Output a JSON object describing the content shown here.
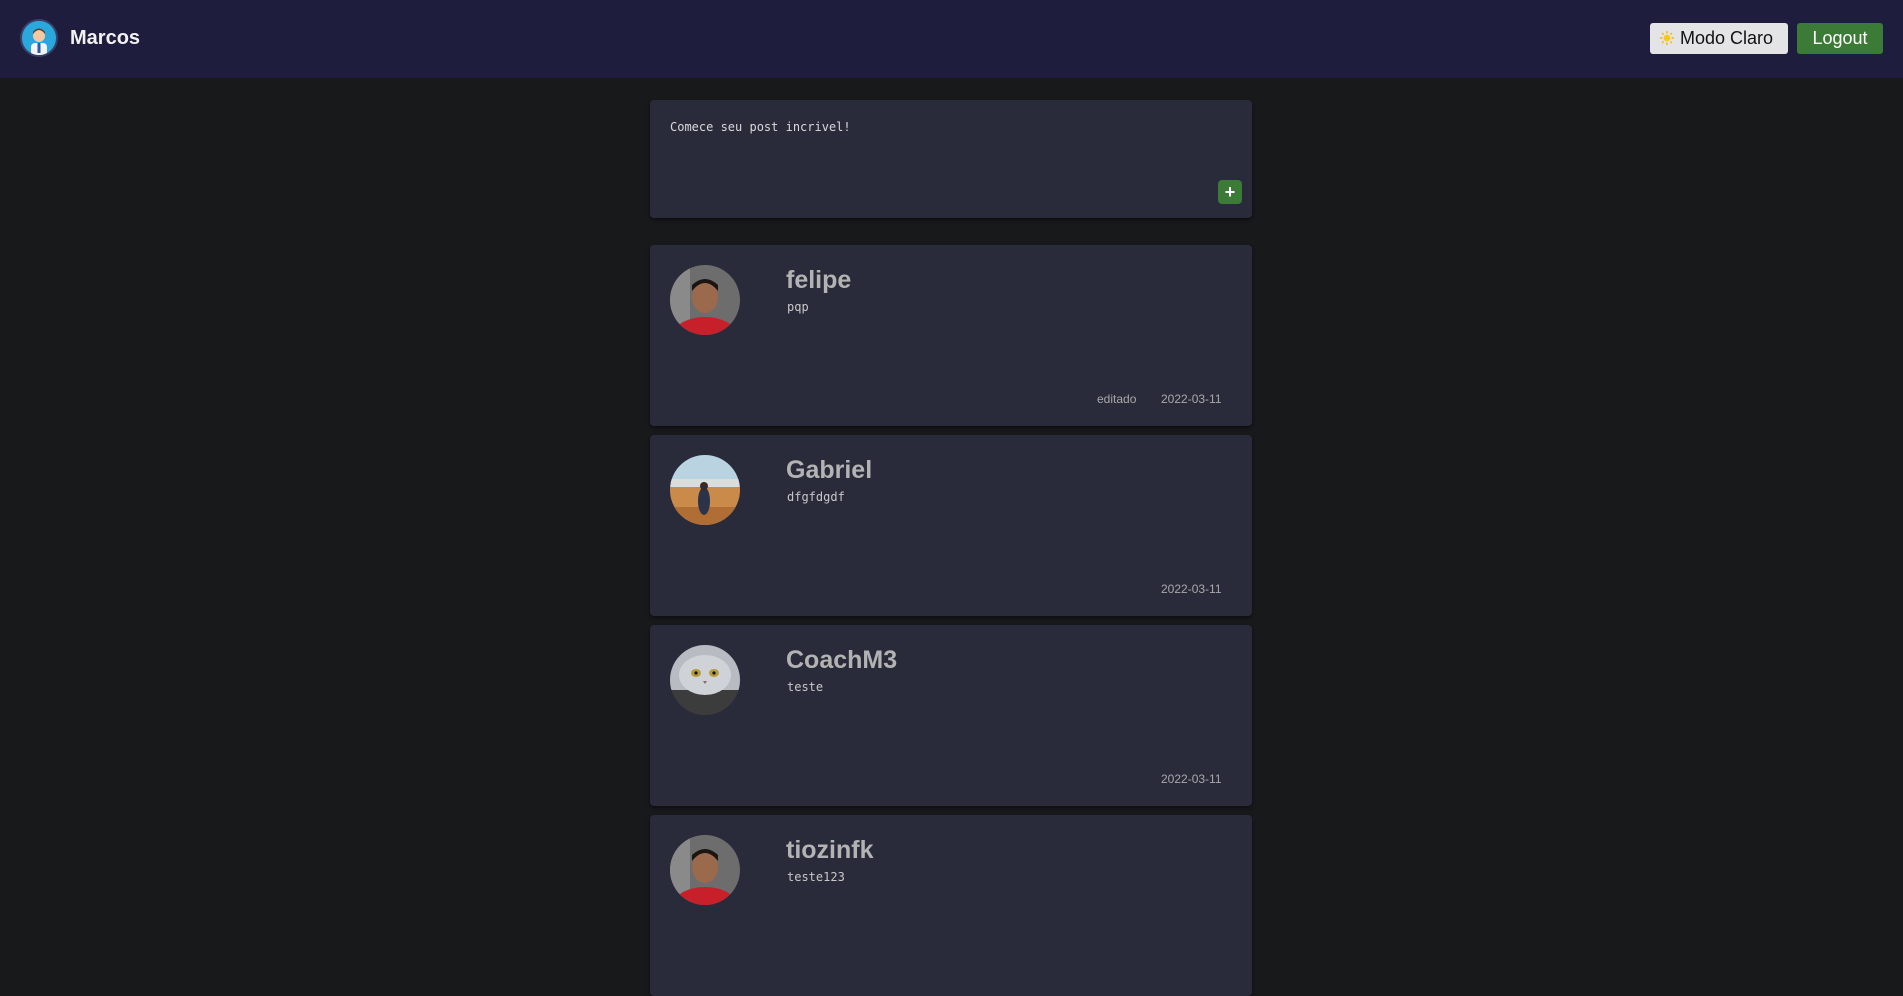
{
  "header": {
    "user_name": "Marcos",
    "theme_button_label": "Modo Claro",
    "theme_icon": "sun-icon",
    "logout_label": "Logout"
  },
  "composer": {
    "placeholder": "Comece seu post incrivel!",
    "add_label": "+"
  },
  "posts": [
    {
      "author": "felipe",
      "body": "pqp",
      "edited": "editado",
      "date": "2022-03-11",
      "avatar": "avatar-photo-man-red-shirt"
    },
    {
      "author": "Gabriel",
      "body": "dfgfdgdf",
      "edited": "",
      "date": "2022-03-11",
      "avatar": "avatar-photo-landscape"
    },
    {
      "author": "CoachM3",
      "body": "teste",
      "edited": "",
      "date": "2022-03-11",
      "avatar": "avatar-photo-cat"
    },
    {
      "author": "tiozinfk",
      "body": "teste123",
      "edited": "",
      "date": "",
      "avatar": "avatar-photo-man-red-shirt"
    }
  ],
  "colors": {
    "header_bg": "#1e1d3d",
    "page_bg": "#18191b",
    "card_bg": "#2a2b3a",
    "accent_green": "#3c7a37"
  }
}
